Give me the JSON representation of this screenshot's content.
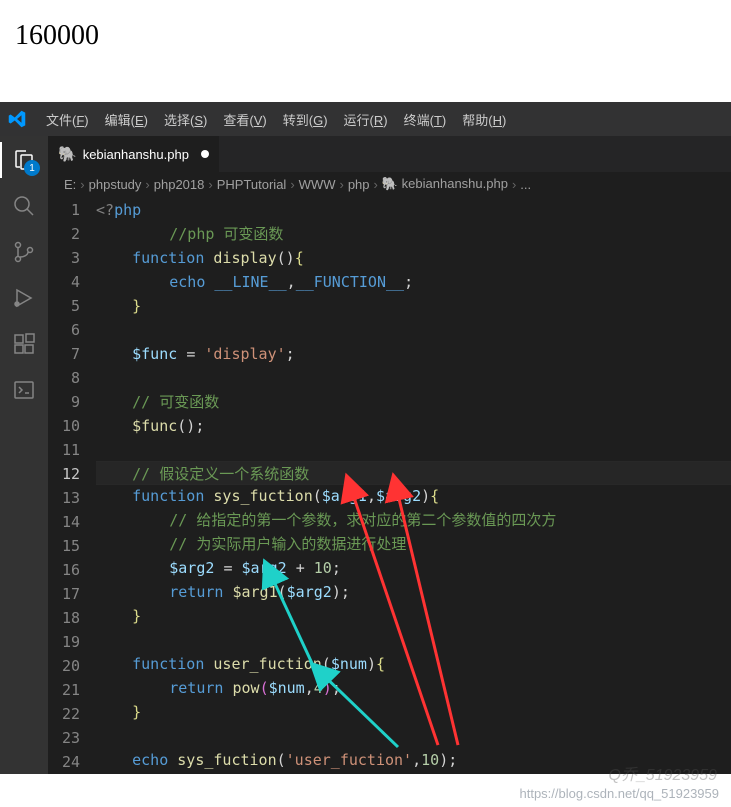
{
  "browser_output": "160000",
  "menu": [
    {
      "label": "文件",
      "key": "F"
    },
    {
      "label": "编辑",
      "key": "E"
    },
    {
      "label": "选择",
      "key": "S"
    },
    {
      "label": "查看",
      "key": "V"
    },
    {
      "label": "转到",
      "key": "G"
    },
    {
      "label": "运行",
      "key": "R"
    },
    {
      "label": "终端",
      "key": "T"
    },
    {
      "label": "帮助",
      "key": "H"
    }
  ],
  "activity_badge": "1",
  "tab": {
    "filename": "kebianhanshu.php",
    "modified": true
  },
  "breadcrumbs": [
    "E:",
    "phpstudy",
    "php2018",
    "PHPTutorial",
    "WWW",
    "php",
    "kebianhanshu.php",
    "..."
  ],
  "code_lines": [
    {
      "n": 1,
      "html": "<span class='c-tag'>&lt;?</span><span class='c-kw'>php</span>"
    },
    {
      "n": 2,
      "html": "    <span class='indent-guide'></span>    <span class='c-comment'>//php 可变函数</span>"
    },
    {
      "n": 3,
      "html": "    <span class='c-kw'>function</span> <span class='c-fn'>display</span><span class='c-punc'>()</span><span class='c-brace'>{</span>"
    },
    {
      "n": 4,
      "html": "    <span class='indent-guide'></span>    <span class='c-kw'>echo</span> <span class='c-const'>__LINE__</span><span class='c-punc'>,</span><span class='c-const'>__FUNCTION__</span><span class='c-punc'>;</span>"
    },
    {
      "n": 5,
      "html": "    <span class='c-brace'>}</span>"
    },
    {
      "n": 6,
      "html": ""
    },
    {
      "n": 7,
      "html": "    <span class='c-var'>$func</span> <span class='c-punc'>=</span> <span class='c-str'>'display'</span><span class='c-punc'>;</span>"
    },
    {
      "n": 8,
      "html": ""
    },
    {
      "n": 9,
      "html": "    <span class='c-comment'>// 可变函数</span>"
    },
    {
      "n": 10,
      "html": "    <span class='c-fn'>$func</span><span class='c-punc'>();</span>"
    },
    {
      "n": 11,
      "html": ""
    },
    {
      "n": 12,
      "current": true,
      "html": "    <span class='c-comment'>// 假设定义一个系统函数</span>"
    },
    {
      "n": 13,
      "html": "    <span class='c-kw'>function</span> <span class='c-fn'>sys_fuction</span><span class='c-punc'>(</span><span class='c-var'>$arg1</span><span class='c-punc'>,</span><span class='c-var'>$arg2</span><span class='c-punc'>)</span><span class='c-brace'>{</span>"
    },
    {
      "n": 14,
      "html": "    <span class='indent-guide'></span>    <span class='c-comment'>// 给指定的第一个参数，求对应的第二个参数值的四次方</span>"
    },
    {
      "n": 15,
      "html": "    <span class='indent-guide'></span>    <span class='c-comment'>// 为实际用户输入的数据进行处理</span>"
    },
    {
      "n": 16,
      "html": "    <span class='indent-guide'></span>    <span class='c-var'>$arg2</span> <span class='c-punc'>=</span> <span class='c-var'>$arg2</span> <span class='c-punc'>+</span> <span class='c-num'>10</span><span class='c-punc'>;</span>"
    },
    {
      "n": 17,
      "html": "    <span class='indent-guide'></span>    <span class='c-kw'>return</span> <span class='c-fn'>$arg1</span><span class='c-punc'>(</span><span class='c-var'>$arg2</span><span class='c-punc'>);</span>"
    },
    {
      "n": 18,
      "html": "    <span class='c-brace'>}</span>"
    },
    {
      "n": 19,
      "html": ""
    },
    {
      "n": 20,
      "html": "    <span class='c-kw'>function</span> <span class='c-fn'>user_fuction</span><span class='c-punc'>(</span><span class='c-var'>$num</span><span class='c-punc'>)</span><span class='c-brace'>{</span>"
    },
    {
      "n": 21,
      "html": "    <span class='indent-guide'></span>    <span class='c-kw'>return</span> <span class='c-fn'>pow</span><span class='c-brace2'>(</span><span class='c-var'>$num</span><span class='c-punc'>,</span><span class='c-num'>4</span><span class='c-brace2'>)</span><span class='c-punc'>;</span>"
    },
    {
      "n": 22,
      "html": "    <span class='c-brace'>}</span>"
    },
    {
      "n": 23,
      "html": ""
    },
    {
      "n": 24,
      "html": "    <span class='c-kw'>echo</span> <span class='c-fn'>sys_fuction</span><span class='c-punc'>(</span><span class='c-str'>'user_fuction'</span><span class='c-punc'>,</span><span class='c-num'>10</span><span class='c-punc'>);</span>"
    }
  ],
  "watermark_url": "https://blog.csdn.net/qq_51923959",
  "watermark_id": "Q乔_51923959"
}
